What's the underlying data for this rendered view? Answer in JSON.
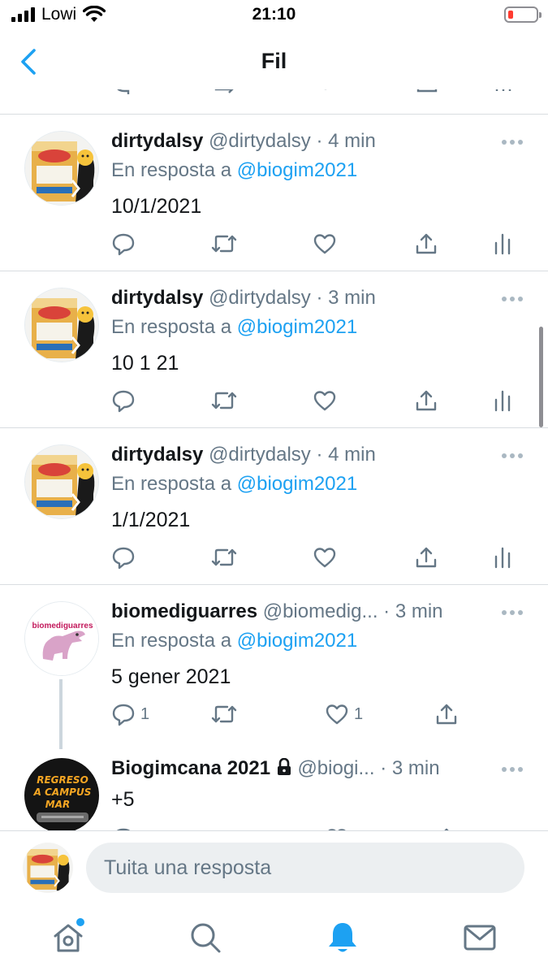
{
  "status_bar": {
    "carrier": "Lowi",
    "time": "21:10",
    "battery_color": "#ff3b30"
  },
  "header": {
    "title": "Fil",
    "back_icon": "chevron-left-icon"
  },
  "colors": {
    "accent": "#1da1f2",
    "secondary_text": "#657786",
    "separator": "#d9dde1"
  },
  "tweets": [
    {
      "name": "dirtydalsy",
      "handle": "@dirtydalsy",
      "dot": "·",
      "time": "4 min",
      "reply_prefix": "En resposta a",
      "reply_to": "@biogim2021",
      "text": "10/1/2021"
    },
    {
      "name": "dirtydalsy",
      "handle": "@dirtydalsy",
      "dot": "·",
      "time": "3 min",
      "reply_prefix": "En resposta a",
      "reply_to": "@biogim2021",
      "text": "10 1 21"
    },
    {
      "name": "dirtydalsy",
      "handle": "@dirtydalsy",
      "dot": "·",
      "time": "4 min",
      "reply_prefix": "En resposta a",
      "reply_to": "@biogim2021",
      "text": "1/1/2021"
    },
    {
      "name": "biomediguarres",
      "handle": "@biomedig...",
      "dot": "·",
      "time": "3 min",
      "reply_prefix": "En resposta a",
      "reply_to": "@biogim2021",
      "text": "5 gener 2021",
      "reply_count": "1",
      "like_count": "1",
      "avatar_text": "biomediguarres"
    },
    {
      "name": "Biogimcana 2021",
      "handle": "@biogi...",
      "dot": "·",
      "time": "3 min",
      "text": "+5",
      "protected": true,
      "avatar_lines": [
        "REGRESO",
        "A CAMPUS",
        "MAR"
      ]
    }
  ],
  "composer": {
    "placeholder": "Tuita una resposta"
  },
  "tabbar": {
    "items": [
      "home-icon",
      "search-icon",
      "notifications-icon",
      "messages-icon"
    ],
    "active": "notifications-icon"
  }
}
